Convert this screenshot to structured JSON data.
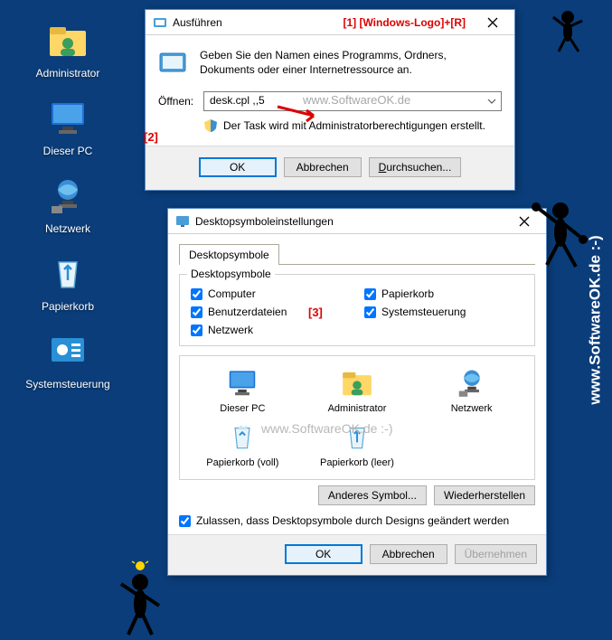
{
  "desktop": {
    "icons": [
      {
        "label": "Administrator",
        "kind": "folder-user"
      },
      {
        "label": "Dieser PC",
        "kind": "pc"
      },
      {
        "label": "Netzwerk",
        "kind": "network"
      },
      {
        "label": "Papierkorb",
        "kind": "recycle"
      },
      {
        "label": "Systemsteuerung",
        "kind": "control"
      }
    ]
  },
  "run_dialog": {
    "title": "Ausführen",
    "annotation1": "[1] [Windows-Logo]+[R]",
    "description": "Geben Sie den Namen eines Programms, Ordners, Dokuments oder einer Internetressource an.",
    "open_label": "Öffnen:",
    "open_value": "desk.cpl ,,5",
    "admin_text": "Der Task wird mit Administratorberechtigungen erstellt.",
    "annotation2": "[2]",
    "ok": "OK",
    "cancel": "Abbrechen",
    "browse": "Durchsuchen...",
    "watermark": "www.SoftwareOK.de"
  },
  "settings_dialog": {
    "title": "Desktopsymboleinstellungen",
    "tab": "Desktopsymbole",
    "group_legend": "Desktopsymbole",
    "checks": {
      "computer": "Computer",
      "userfiles": "Benutzerdateien",
      "network": "Netzwerk",
      "recycle": "Papierkorb",
      "control": "Systemsteuerung"
    },
    "annotation3": "[3]",
    "preview": [
      {
        "label": "Dieser PC",
        "kind": "pc"
      },
      {
        "label": "Administrator",
        "kind": "folder-user"
      },
      {
        "label": "Netzwerk",
        "kind": "network"
      },
      {
        "label": "Papierkorb (voll)",
        "kind": "recycle-full"
      },
      {
        "label": "Papierkorb (leer)",
        "kind": "recycle"
      }
    ],
    "watermark": "www.SoftwareOK.de :-)",
    "change_icon": "Anderes Symbol...",
    "restore": "Wiederherstellen",
    "allow_themes": "Zulassen, dass Desktopsymbole durch Designs geändert werden",
    "ok": "OK",
    "cancel": "Abbrechen",
    "apply": "Übernehmen"
  },
  "sidebar_text": "www.SoftwareOK.de :-)"
}
